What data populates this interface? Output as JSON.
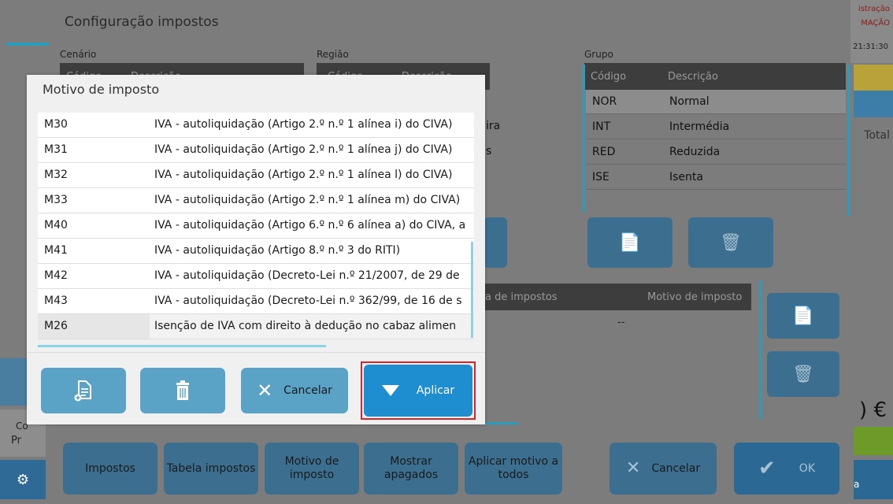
{
  "background_app": {
    "right_top_line1": "istração",
    "right_top_line2": "MAÇÃO",
    "time": "21:31:30",
    "total_label": "Total",
    "amount": ") €",
    "left_text1": "Co",
    "left_text2": "Pr",
    "right_btn_label": "a"
  },
  "config_dialog": {
    "title": "Configuração impostos",
    "cenario_label": "Cenário",
    "regiao_label": "Região",
    "grupo_label": "Grupo",
    "cenario_header": {
      "code": "Código",
      "desc": "Descrição"
    },
    "regiao_header": {
      "code": "Código",
      "desc": "Descrição"
    },
    "grupo_header": {
      "code": "Código",
      "desc": "Descrição"
    },
    "regiao_peek": [
      "ira",
      "s"
    ],
    "grupo_rows": [
      {
        "code": "NOR",
        "desc": "Normal"
      },
      {
        "code": "INT",
        "desc": "Intermédia"
      },
      {
        "code": "RED",
        "desc": "Reduzida"
      },
      {
        "code": "ISE",
        "desc": "Isenta"
      }
    ],
    "lower_table_header": {
      "col1": "a de impostos",
      "col2": "Motivo de imposto"
    },
    "lower_table_value": "--",
    "bottom_buttons": {
      "impostos": "Impostos",
      "tabela_impostos": "Tabela impostos",
      "motivo_imposto": "Motivo de imposto",
      "mostrar_apagados": "Mostrar apagados",
      "aplicar_motivo": "Aplicar motivo a todos",
      "cancelar": "Cancelar",
      "ok": "OK"
    }
  },
  "motivo_modal": {
    "title": "Motivo de imposto",
    "rows": [
      {
        "code": "M30",
        "desc": "IVA - autoliquidação (Artigo 2.º n.º 1 alínea i) do CIVA)"
      },
      {
        "code": "M31",
        "desc": "IVA - autoliquidação (Artigo 2.º n.º 1 alínea j) do CIVA)"
      },
      {
        "code": "M32",
        "desc": "IVA - autoliquidação (Artigo 2.º n.º 1 alínea l) do CIVA)"
      },
      {
        "code": "M33",
        "desc": "IVA - autoliquidação (Artigo 2.º n.º 1 alínea m) do CIVA)"
      },
      {
        "code": "M40",
        "desc": "IVA - autoliquidação (Artigo 6.º n.º 6 alínea a) do CIVA, a"
      },
      {
        "code": "M41",
        "desc": "IVA - autoliquidação (Artigo 8.º n.º 3 do RITI)"
      },
      {
        "code": "M42",
        "desc": "IVA - autoliquidação (Decreto-Lei n.º 21/2007, de 29 de"
      },
      {
        "code": "M43",
        "desc": "IVA - autoliquidação (Decreto-Lei n.º 362/99, de 16 de s"
      },
      {
        "code": "M26",
        "desc": "Isenção de IVA com direito à dedução no cabaz alimen"
      }
    ],
    "selected_code": "M26",
    "cancel_label": "Cancelar",
    "apply_label": "Aplicar"
  },
  "colors": {
    "accent_blue": "#1e8ed1",
    "button_blue": "#5aa3c7",
    "highlight_red": "#d8232a",
    "scroll_cyan": "#8cd2e6"
  }
}
